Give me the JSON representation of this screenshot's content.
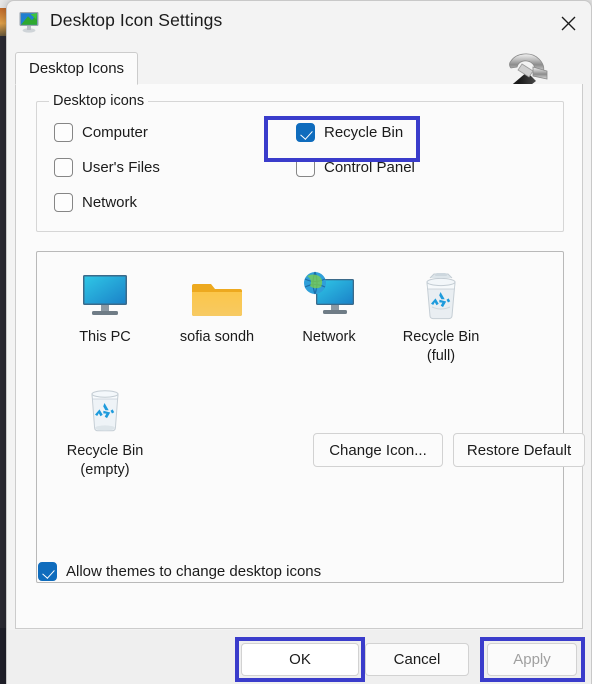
{
  "window": {
    "title": "Desktop Icon Settings",
    "icon": "desktop-monitor-icon",
    "close_label": "✕"
  },
  "tabs": [
    {
      "label": "Desktop Icons",
      "selected": true
    }
  ],
  "decor": {
    "hammer_icon": "hammer-icon"
  },
  "group": {
    "legend": "Desktop icons",
    "checkboxes": [
      {
        "label": "Computer",
        "checked": false,
        "column": "left",
        "row": 0
      },
      {
        "label": "User's Files",
        "checked": false,
        "column": "left",
        "row": 1
      },
      {
        "label": "Network",
        "checked": false,
        "column": "left",
        "row": 2
      },
      {
        "label": "Recycle Bin",
        "checked": true,
        "column": "right",
        "row": 0,
        "highlighted": true
      },
      {
        "label": "Control Panel",
        "checked": false,
        "column": "right",
        "row": 1
      }
    ]
  },
  "preview": {
    "items": [
      {
        "label": "This PC",
        "icon": "monitor-icon"
      },
      {
        "label": "sofia sondh",
        "icon": "folder-icon"
      },
      {
        "label": "Network",
        "icon": "network-globe-monitor-icon"
      },
      {
        "label": "Recycle Bin\n(full)",
        "label_line1": "Recycle Bin",
        "label_line2": "(full)",
        "icon": "recycle-bin-full-icon"
      },
      {
        "label": "Recycle Bin\n(empty)",
        "label_line1": "Recycle Bin",
        "label_line2": "(empty)",
        "icon": "recycle-bin-empty-icon"
      }
    ]
  },
  "actions": {
    "change_icon": "Change Icon...",
    "restore_default": "Restore Default"
  },
  "allow_themes": {
    "label": "Allow themes to change desktop icons",
    "checked": true
  },
  "footer": {
    "ok": "OK",
    "cancel": "Cancel",
    "apply": "Apply",
    "apply_disabled": true
  },
  "highlights": {
    "color": "#3a3ccb",
    "targets": [
      "recycle-bin-checkbox",
      "ok-button",
      "apply-button"
    ]
  }
}
